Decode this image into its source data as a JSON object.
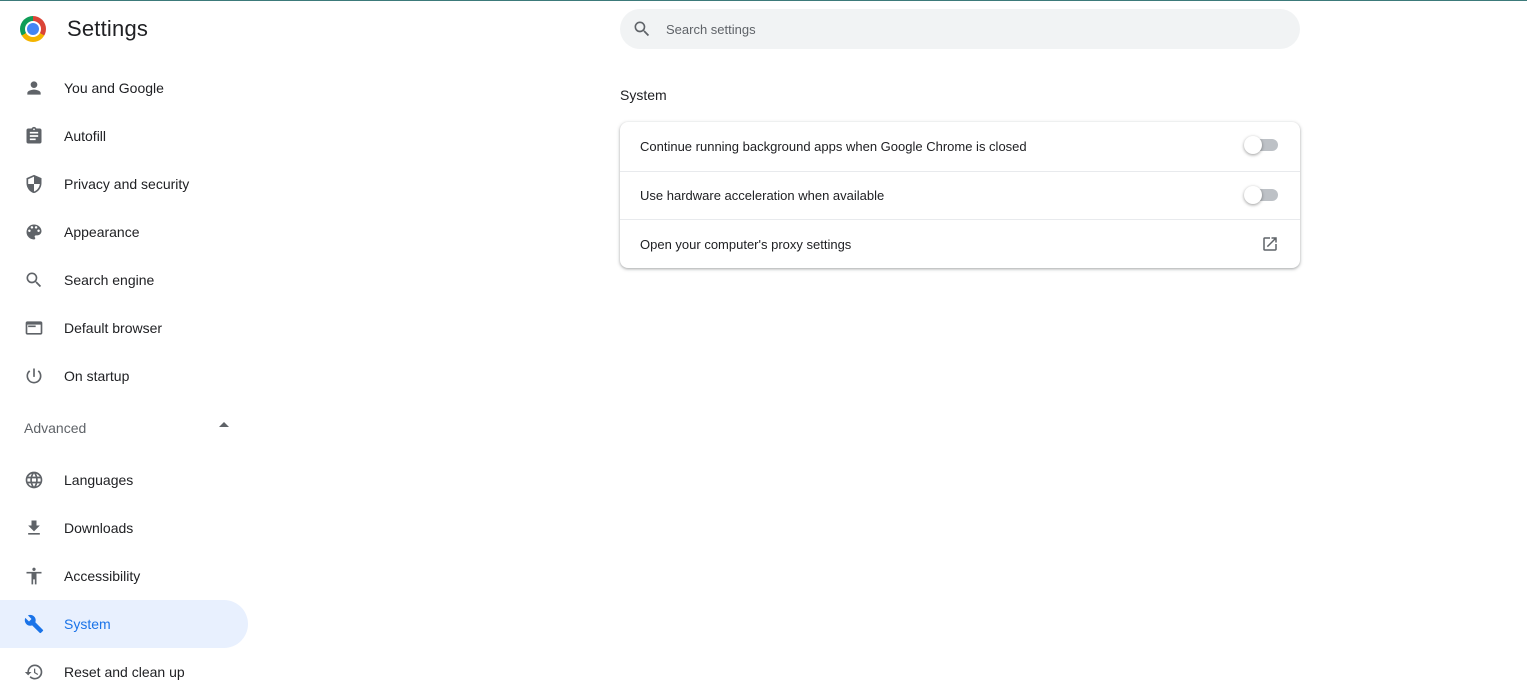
{
  "header": {
    "app_title": "Settings",
    "logo_icon": "chrome-logo-icon",
    "search": {
      "placeholder": "Search settings",
      "value": "",
      "icon": "search-icon"
    }
  },
  "sidebar": {
    "items": [
      {
        "label": "You and Google",
        "icon": "person-icon"
      },
      {
        "label": "Autofill",
        "icon": "clipboard-icon"
      },
      {
        "label": "Privacy and security",
        "icon": "shield-icon"
      },
      {
        "label": "Appearance",
        "icon": "palette-icon"
      },
      {
        "label": "Search engine",
        "icon": "search-icon"
      },
      {
        "label": "Default browser",
        "icon": "browser-window-icon"
      },
      {
        "label": "On startup",
        "icon": "power-icon"
      }
    ],
    "advanced": {
      "label": "Advanced",
      "expanded": true,
      "icon": "caret-up-icon"
    },
    "advanced_items": [
      {
        "label": "Languages",
        "icon": "globe-icon"
      },
      {
        "label": "Downloads",
        "icon": "download-icon"
      },
      {
        "label": "Accessibility",
        "icon": "accessibility-icon"
      },
      {
        "label": "System",
        "icon": "wrench-icon",
        "active": true
      },
      {
        "label": "Reset and clean up",
        "icon": "history-icon"
      }
    ]
  },
  "main": {
    "section_title": "System",
    "rows": [
      {
        "label": "Continue running background apps when Google Chrome is closed",
        "control": "toggle",
        "on": false
      },
      {
        "label": "Use hardware acceleration when available",
        "control": "toggle",
        "on": false
      },
      {
        "label": "Open your computer's proxy settings",
        "control": "external-link",
        "icon": "open-in-new-icon"
      }
    ]
  },
  "colors": {
    "accent": "#1a73e8",
    "active_bg": "#e8f0fe",
    "icon": "#5f6368",
    "toggle_off": "#bdc1c6",
    "search_bg": "#f1f3f4"
  }
}
